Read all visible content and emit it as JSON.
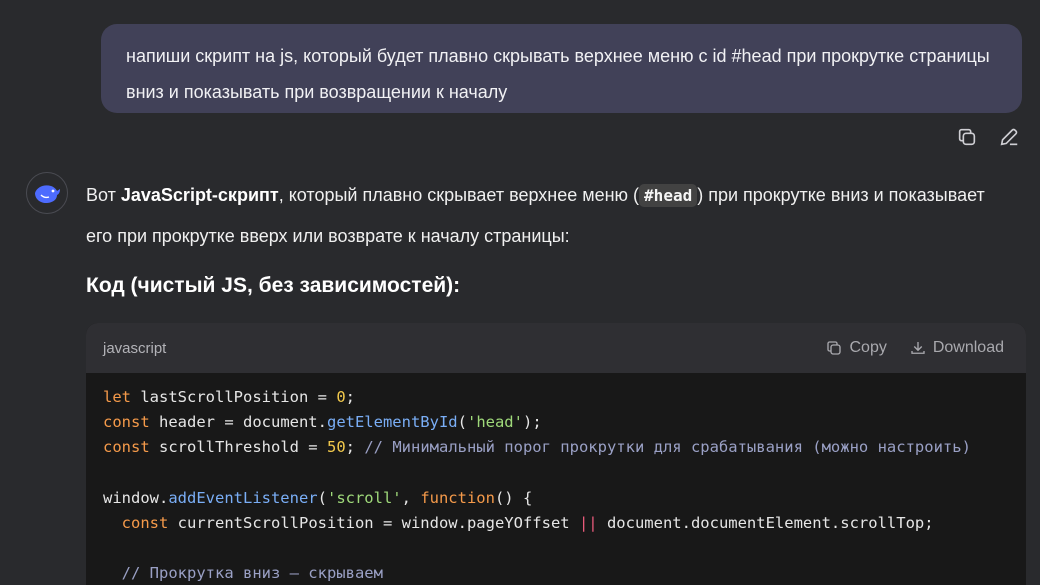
{
  "user_message": "напиши скрипт на js, который будет плавно скрывать верхнее меню с id #head при прокрутке страницы вниз и показывать при возвращении к началу",
  "message_actions": {
    "copy_icon": "copy-icon",
    "edit_icon": "edit-icon"
  },
  "assistant": {
    "avatar_icon": "deepseek-whale-icon",
    "intro_part1": "Вот ",
    "intro_bold": "JavaScript-скрипт",
    "intro_part2": ", который плавно скрывает верхнее меню (",
    "intro_code": "#head",
    "intro_part3": ") при прокрутке вниз и показывает его при прокрутке вверх или возврате к началу страницы:",
    "heading": "Код (чистый JS, без зависимостей):"
  },
  "code_block": {
    "language": "javascript",
    "copy_label": "Copy",
    "download_label": "Download",
    "line1": {
      "kw": "let",
      "var": " lastScrollPosition = ",
      "num": "0",
      "end": ";"
    },
    "line2": {
      "kw": "const",
      "mid": " header = document.",
      "fn": "getElementById",
      "open": "(",
      "str": "'head'",
      "end": ");"
    },
    "line3": {
      "kw": "const",
      "mid": " scrollThreshold = ",
      "num": "50",
      "end": "; ",
      "comment": "// Минимальный порог прокрутки для срабатывания (можно настроить)"
    },
    "line5": {
      "start": "window.",
      "fn": "addEventListener",
      "open": "(",
      "str": "'scroll'",
      "sep": ", ",
      "kw": "function",
      "end": "() {"
    },
    "line6": {
      "indent": "  ",
      "kw": "const",
      "mid": " currentScrollPosition = window.pageYOffset ",
      "op": "||",
      "end": " document.documentElement.scrollTop;"
    },
    "line8": {
      "indent": "  ",
      "comment": "// Прокрутка вниз — скрываем"
    }
  },
  "colors": {
    "background": "#292a2d",
    "user_bubble": "#414158",
    "code_bg": "#181818",
    "code_header": "#2f2f33"
  }
}
